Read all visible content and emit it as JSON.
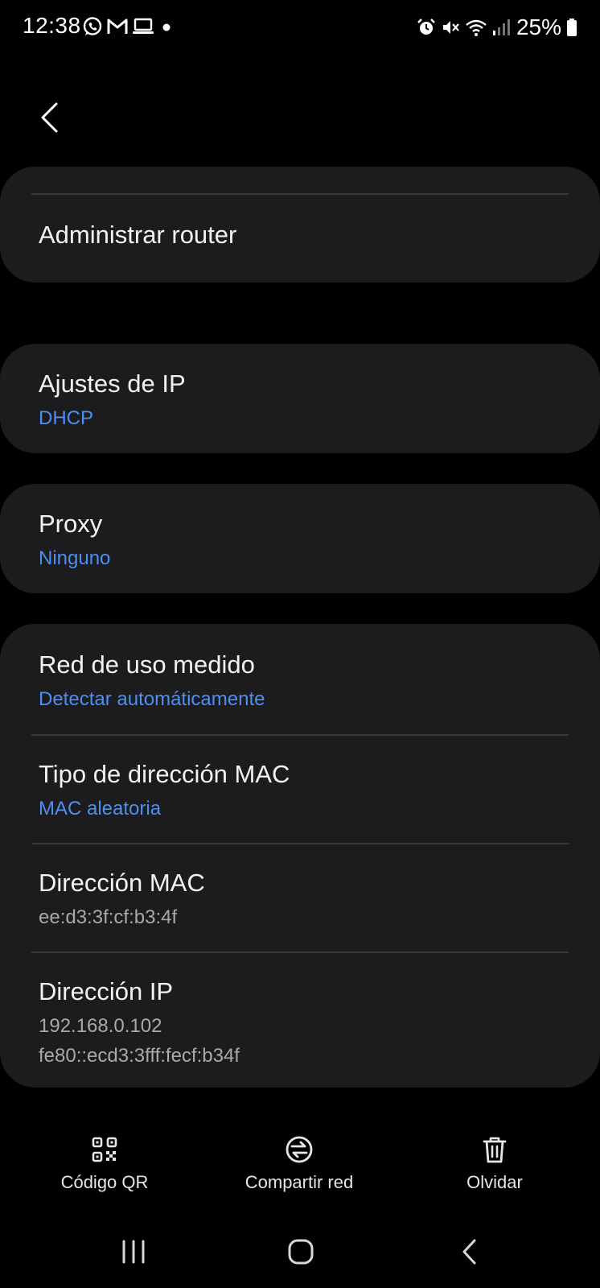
{
  "status_bar": {
    "time": "12:38",
    "battery_percent": "25%",
    "left_icons": [
      "whatsapp-icon",
      "gmail-icon",
      "laptop-icon",
      "dot-icon"
    ],
    "right_icons": [
      "alarm-icon",
      "mute-icon",
      "wifi-icon",
      "signal-icon",
      "battery-icon"
    ]
  },
  "header": {
    "back_icon": "chevron-left-icon"
  },
  "router_card": {
    "manage_router_label": "Administrar router"
  },
  "ip_settings": {
    "title": "Ajustes de IP",
    "value": "DHCP"
  },
  "proxy": {
    "title": "Proxy",
    "value": "Ninguno"
  },
  "network_details": {
    "metered": {
      "title": "Red de uso medido",
      "value": "Detectar automáticamente"
    },
    "mac_type": {
      "title": "Tipo de dirección MAC",
      "value": "MAC aleatoria"
    },
    "mac_address": {
      "title": "Dirección MAC",
      "value": "ee:d3:3f:cf:b3:4f"
    },
    "ip_address": {
      "title": "Dirección IP",
      "ipv4": "192.168.0.102",
      "ipv6": "fe80::ecd3:3fff:fecf:b34f"
    }
  },
  "actions": {
    "qr_label": "Código QR",
    "share_label": "Compartir red",
    "forget_label": "Olvidar"
  },
  "colors": {
    "background": "#000000",
    "card": "#1c1c1e",
    "accent": "#4d8ff0",
    "secondary_text": "#a9a9ab"
  }
}
